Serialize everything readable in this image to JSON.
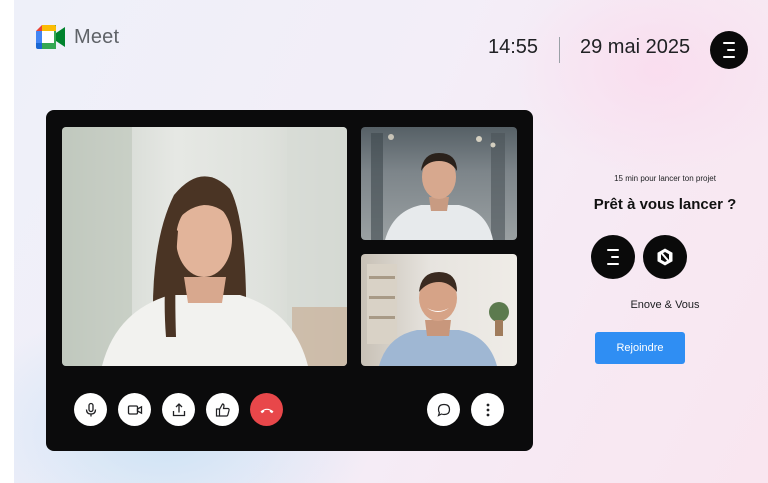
{
  "app": {
    "name": "Meet",
    "logo_icon": "google-meet-logo-icon"
  },
  "header": {
    "time": "14:55",
    "date": "29 mai 2025",
    "avatar_icon": "enove-e-icon"
  },
  "call": {
    "participants": [
      {
        "tile": "main",
        "icon": "person-woman"
      },
      {
        "tile": "top-right",
        "icon": "person-man"
      },
      {
        "tile": "bottom-right",
        "icon": "person-man"
      }
    ],
    "controls_left": [
      "microphone-icon",
      "camera-icon",
      "share-screen-icon",
      "thumbs-up-icon",
      "hang-up-icon"
    ],
    "controls_right": [
      "chat-icon",
      "more-vertical-icon"
    ],
    "hangup_color": "#e8474a"
  },
  "side": {
    "subtitle": "15 min pour lancer ton projet",
    "title": "Prêt à vous lancer ?",
    "brands_label": "Enove & Vous",
    "join_label": "Rejoindre",
    "join_color": "#2f8ef3"
  }
}
